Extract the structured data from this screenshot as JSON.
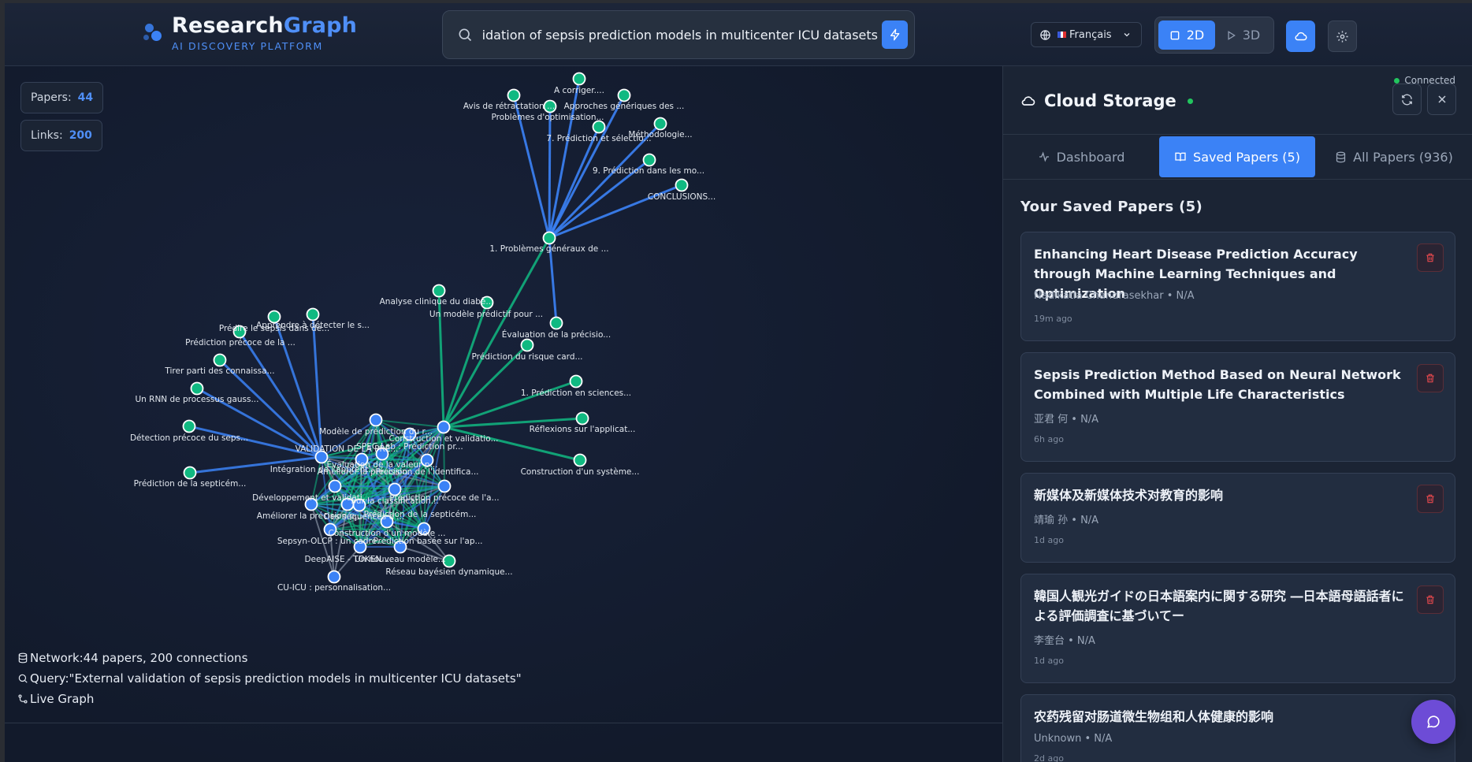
{
  "app": {
    "brand_part1": "Research",
    "brand_part2": "Graph",
    "tagline": "AI DISCOVERY PLATFORM"
  },
  "colors": {
    "accent": "#3b82f6",
    "node_blue": "#3b82f6",
    "node_green": "#10b981",
    "link_blue": "#3b82f6",
    "link_green": "#10b981",
    "status_green": "#22c55e"
  },
  "search": {
    "value": "External validation of sepsis prediction models in multicenter ICU datasets",
    "submit_icon": "lightning-icon"
  },
  "language": {
    "label": "Français",
    "icon": "globe-icon"
  },
  "view_toggle": {
    "option_2d": "2D",
    "option_3d": "3D",
    "selected": "2D"
  },
  "graph": {
    "papers_label": "Papers:",
    "papers_count": "44",
    "links_label": "Links:",
    "links_count": "200",
    "labels": {
      "n1": "A corriger....",
      "n2": "Avis de rétractation ...",
      "n3": "Approches génériques des ...",
      "n4": "Problèmes d'optimisation...",
      "n5": "7. Prédiction et sélectio...",
      "n6": "Méthodologie...",
      "n7": "9. Prédiction dans les mo...",
      "n8": "CONCLUSIONS...",
      "hub1": "1. Problèmes généraux de ...",
      "m1": "Analyse clinique du diabè...",
      "m2": "Un modèle prédictif pour ...",
      "m3": "Évaluation de la précisio...",
      "m4": "Prédiction du risque card...",
      "m5": "1. Prédiction en sciences...",
      "m6": "Réflexions sur l'applicat...",
      "m7": "Construction d'un système...",
      "l1": "Prédire le sepsis dans de...",
      "l2": "Apprendre à détecter le s...",
      "l3": "Prédiction précoce de la ...",
      "l4": "Tirer parti des connaissa...",
      "l5": "Un RNN de processus gauss...",
      "l6": "Détection précoce du seps...",
      "l7": "Prédiction de la septicém...",
      "c1": "Modèle de prédiction du r...",
      "c2": "VALIDATION DE LA PRÉ...",
      "c3": "SPEC-Lab : Prédiction pr...",
      "c4": "Construction et validatio...",
      "c5": "Intégration de l'apprent...",
      "c6": "Évaluation de la valeur p...",
      "c7": "Améliorer la précision...",
      "c8": "Précision de l'identifica...",
      "c9": "Développement et validati...",
      "c10": "Sur la classification...",
      "c11": "Prédiction précoce de l'a...",
      "c12": "Améliorer la précision p...",
      "c13": "Des séquences d'...",
      "c14": "Prédiction de la septicém...",
      "c15": "Sepsyn-OLCP : un cadre...",
      "c16": "Construction d'un modèle ...",
      "c17": "Prédiction basée sur l'ap...",
      "c18": "DeepAISE - TOKEN ...",
      "c19": "Un nouveau modèle...",
      "c20": "Réseau bayésien dynamique...",
      "c21": "CU-ICU : personnalisation..."
    }
  },
  "status": {
    "network": "Network:44 papers, 200 connections",
    "query": "Query:\"External validation of sepsis prediction models in multicenter ICU datasets\"",
    "mode": "Live Graph"
  },
  "panel": {
    "connection": "Connected",
    "title": "Cloud Storage",
    "tabs": [
      {
        "label": "Dashboard",
        "icon": "activity-icon"
      },
      {
        "label": "Saved Papers (5)",
        "icon": "book-icon"
      },
      {
        "label": "All Papers (936)",
        "icon": "database-icon"
      }
    ],
    "section_title": "Your Saved Papers (5)",
    "papers": [
      {
        "title": "Enhancing Heart Disease Prediction Accuracy through Machine Learning Techniques and Optimization",
        "meta": "Nadikatla Chandrasekhar • N/A",
        "time": "19m ago"
      },
      {
        "title": "Sepsis Prediction Method Based on Neural Network Combined with Multiple Life Characteristics",
        "meta": "亚君 何 • N/A",
        "time": "6h ago"
      },
      {
        "title": "新媒体及新媒体技术对教育的影响",
        "meta": "靖瑜 孙 • N/A",
        "time": "1d ago"
      },
      {
        "title": "韓国人観光ガイドの日本語案内に関する研究 ―日本語母語話者による評価調査に基づいてー",
        "meta": "李奎台 • N/A",
        "time": "1d ago"
      },
      {
        "title": "农药残留对肠道微生物组和人体健康的影响",
        "meta": "Unknown • N/A",
        "time": "2d ago"
      }
    ]
  }
}
